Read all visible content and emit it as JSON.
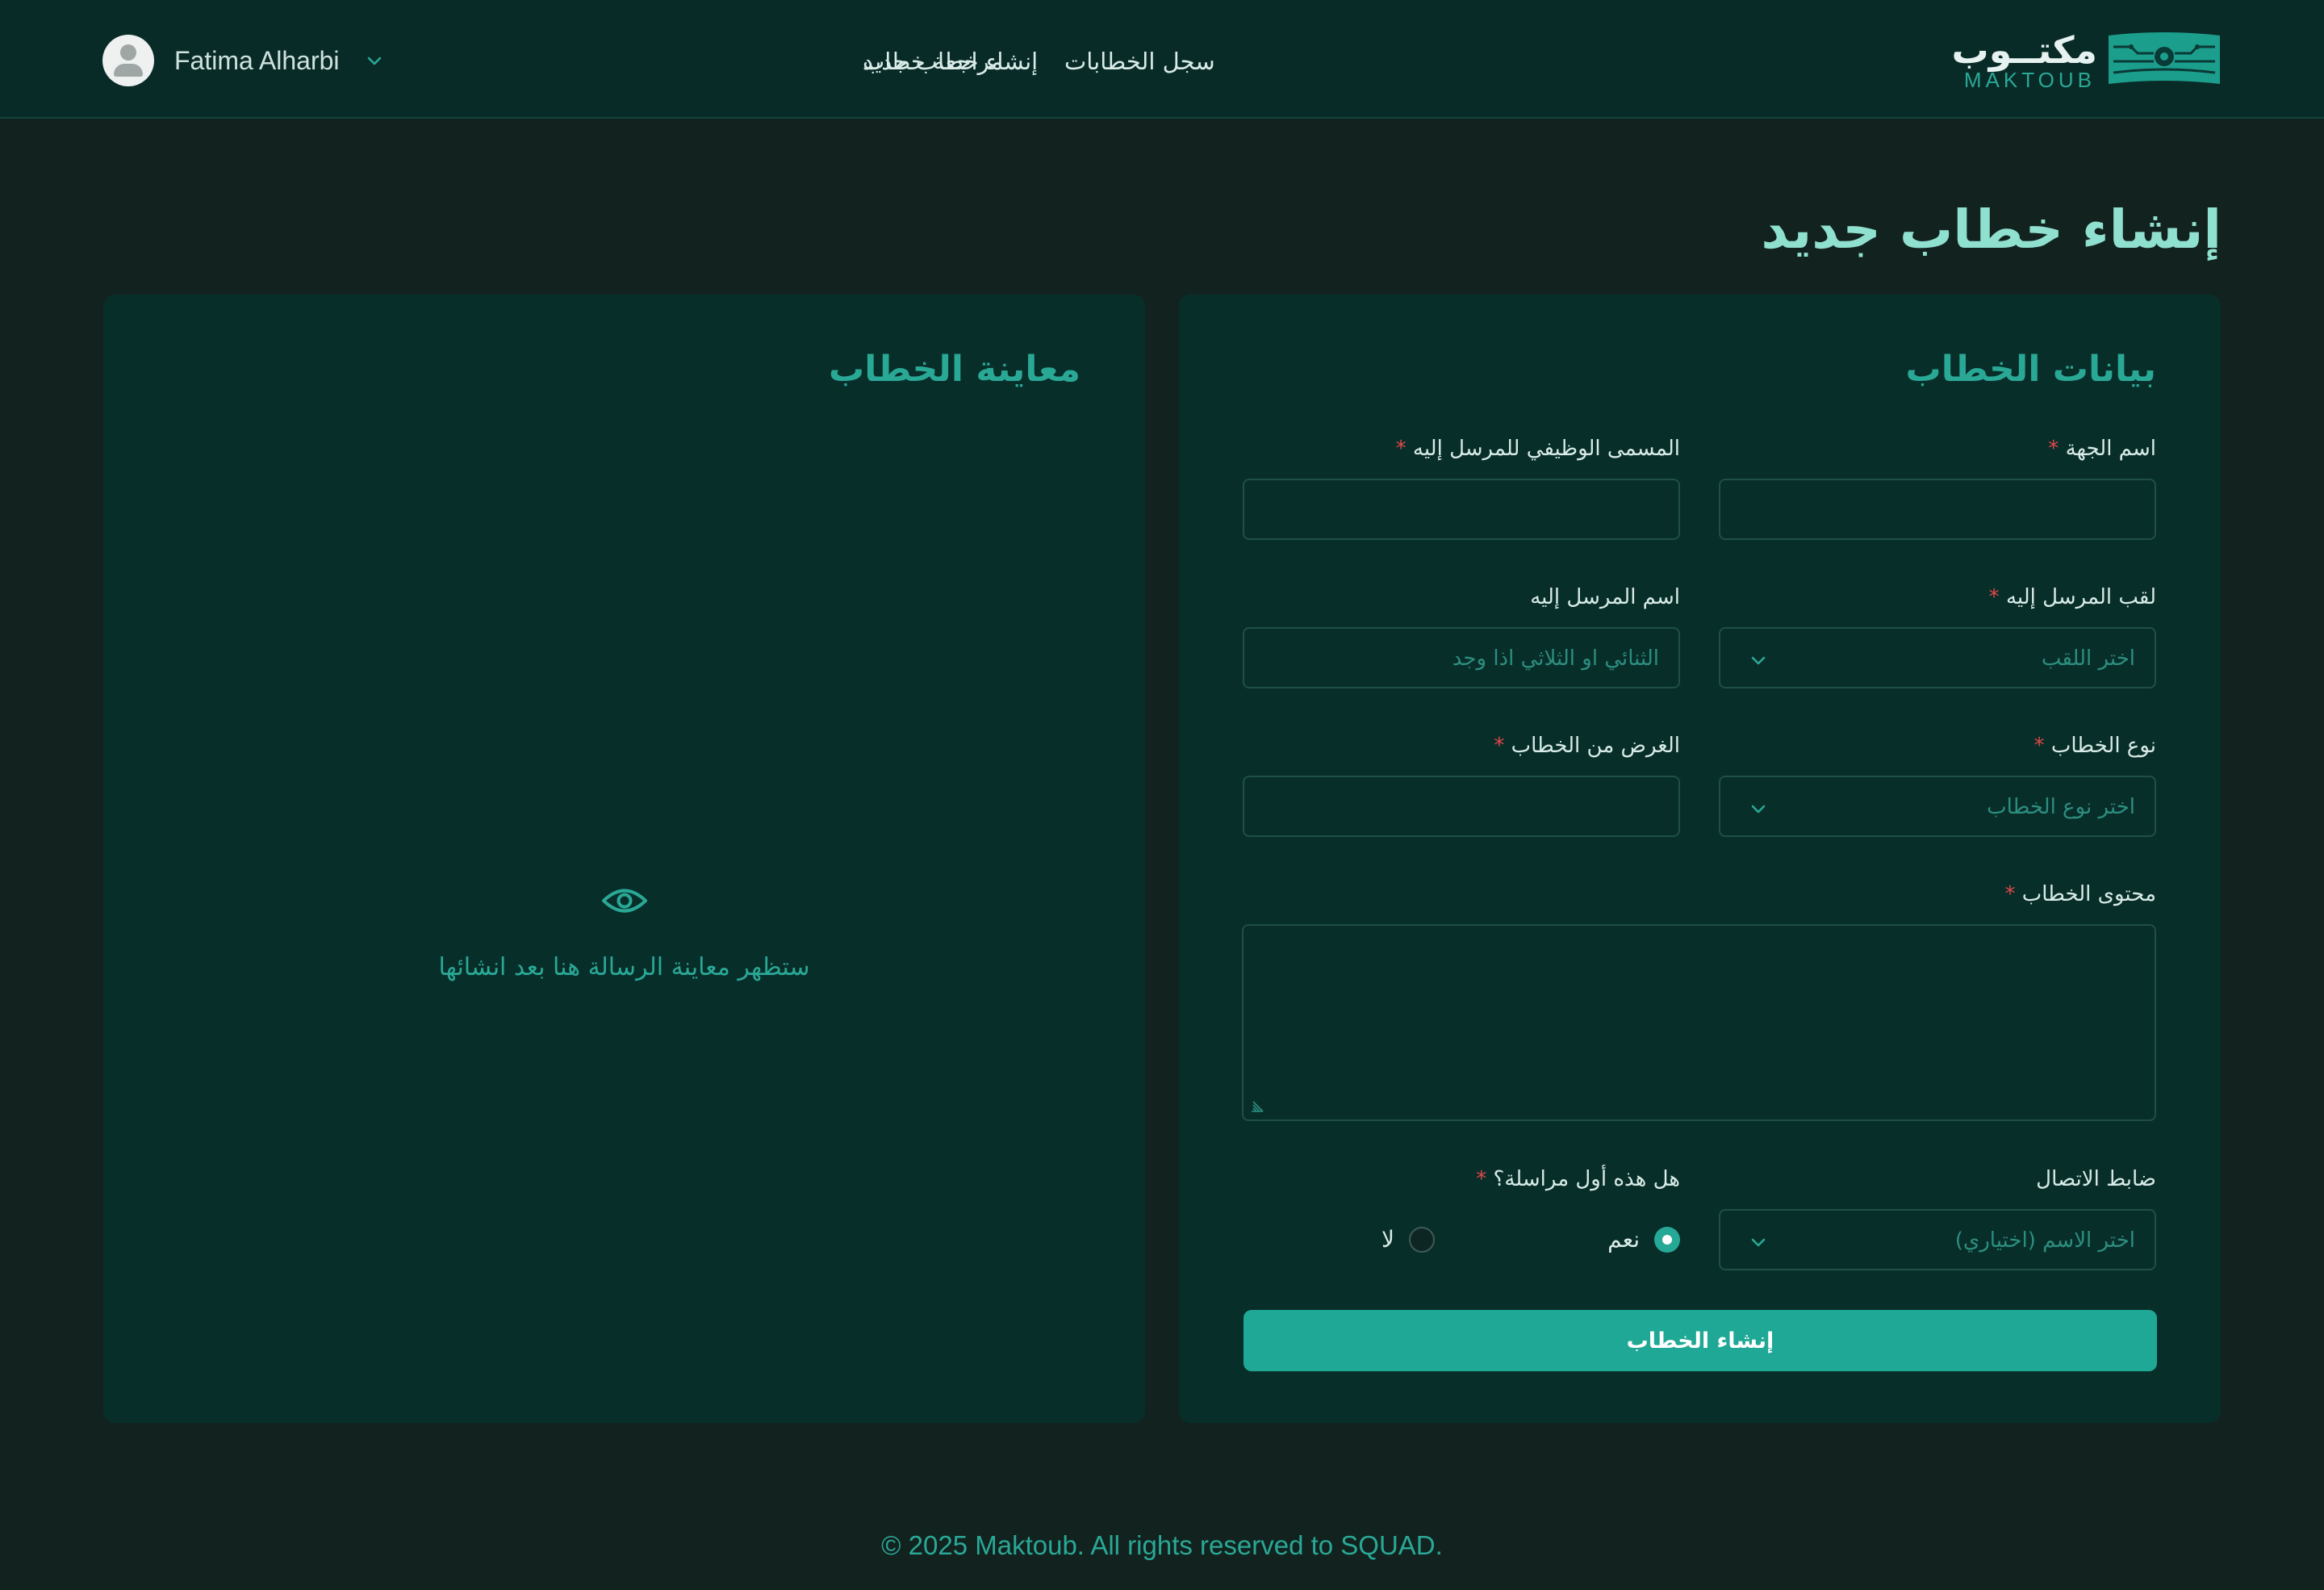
{
  "header": {
    "user_name": "Fatima Alharbi",
    "logo_arabic": "مكتــوب",
    "logo_english": "MAKTOUB",
    "nav": [
      "إنشاء خطاب جديد",
      "سجل الخطابات",
      "مراجعة خطاب"
    ]
  },
  "page_title": "إنشاء خطاب جديد",
  "form": {
    "title": "بيانات الخطاب",
    "entity_name_label": "اسم الجهة",
    "job_title_label": "المسمى الوظيفي للمرسل إليه",
    "recipient_title_label": "لقب المرسل إليه",
    "recipient_title_placeholder": "اختر اللقب",
    "recipient_name_label": "اسم المرسل إليه",
    "recipient_name_placeholder": "الثنائي او الثلاثي اذا وجد",
    "letter_type_label": "نوع الخطاب",
    "letter_type_placeholder": "اختر نوع الخطاب",
    "purpose_label": "الغرض من الخطاب",
    "content_label": "محتوى الخطاب",
    "contact_label": "ضابط الاتصال",
    "contact_placeholder": "اختر الاسم (اختياري)",
    "first_correspondence_label": "هل هذه أول مراسلة؟",
    "yes_label": "نعم",
    "no_label": "لا",
    "required_mark": "*",
    "submit_label": "إنشاء الخطاب"
  },
  "preview": {
    "title": "معاينة الخطاب",
    "empty_message": "ستظهر معاينة الرسالة هنا بعد انشائها"
  },
  "footer": "© 2025 Maktoub. All rights reserved to SQUAD.",
  "colors": {
    "page_bg": "#12221f",
    "header_bg": "#092b28",
    "card_bg": "#082e2a",
    "accent": "#1fa896",
    "title_accent": "#8fe0cf",
    "required": "#e04848"
  },
  "icons": {
    "avatar": "user-avatar-icon",
    "user_menu": "chevron-down-icon",
    "select": "chevron-down-icon",
    "preview": "eye-icon",
    "textarea_resize": "resize-handle-icon",
    "logo": "maktoub-logo-mark"
  }
}
